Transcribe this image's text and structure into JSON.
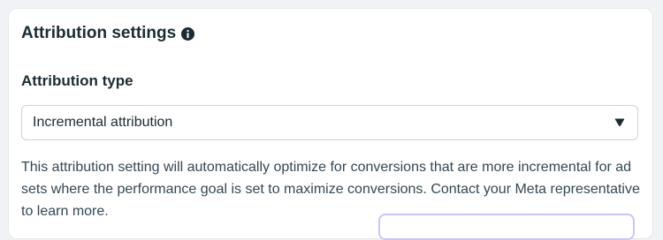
{
  "attribution_settings": {
    "title": "Attribution settings",
    "info_icon": "info-circle-icon",
    "attribution_type": {
      "label": "Attribution type",
      "selected_value": "Incremental attribution",
      "dropdown_icon": "caret-down-icon"
    },
    "description": "This attribution setting will automatically optimize for conversions that are more incremental for ad sets where the performance goal is set to maximize conversions. Contact your Meta representative to learn more."
  },
  "colors": {
    "page_background": "#f0f2f5",
    "card_background": "#ffffff",
    "text_primary": "#1c2b33",
    "text_secondary": "#344854",
    "border": "#cbd2d9",
    "button_outline": "#cfc4f7"
  }
}
